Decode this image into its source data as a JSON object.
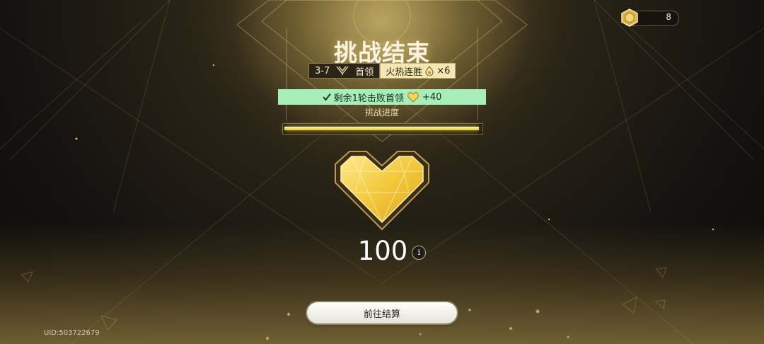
{
  "header": {
    "currency_amount": "8",
    "currency_icon": "gold-hexagon-coin-icon"
  },
  "result": {
    "title": "挑战结束",
    "stage": "3-7",
    "stage_type": "首领",
    "streak_label": "火热连胜",
    "streak_count": "×6",
    "boss_icon": "boss-emblem-icon",
    "fire_icon": "flame-drop-icon"
  },
  "reward": {
    "text": "剩余1轮击败首领",
    "bonus": "+40",
    "check_icon": "check-icon",
    "heart_icon": "gold-heart-icon"
  },
  "progress": {
    "label": "挑战进度",
    "fraction": 0.99
  },
  "score": {
    "value": "100",
    "info_symbol": "i"
  },
  "actions": {
    "settle_label": "前往结算"
  },
  "footer": {
    "uid": "UID:503722679"
  },
  "colors": {
    "accent_gold": "#f6df5c",
    "reward_green": "#a7eeba",
    "heart_gold": "#f3c93c"
  }
}
